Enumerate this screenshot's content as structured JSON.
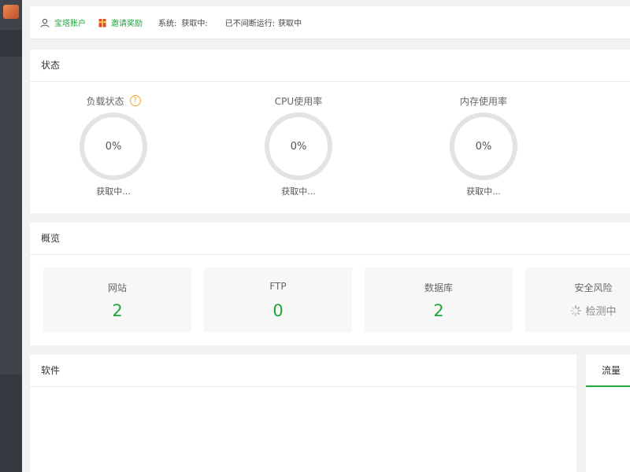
{
  "topbar": {
    "account_label": "宝塔账户",
    "invite_label": "邀请奖励",
    "system_label": "系统:",
    "system_value": "获取中:",
    "uptime_label": "已不间断运行:",
    "uptime_value": "获取中"
  },
  "status": {
    "title": "状态",
    "gauges": [
      {
        "title": "负载状态",
        "value": "0%",
        "sub": "获取中...",
        "percent": 0
      },
      {
        "title": "CPU使用率",
        "value": "0%",
        "sub": "获取中...",
        "percent": 0
      },
      {
        "title": "内存使用率",
        "value": "0%",
        "sub": "获取中...",
        "percent": 0
      }
    ],
    "help_glyph": "?"
  },
  "overview": {
    "title": "概览",
    "cards": [
      {
        "label": "网站",
        "value": "2"
      },
      {
        "label": "FTP",
        "value": "0"
      },
      {
        "label": "数据库",
        "value": "2"
      },
      {
        "label": "安全风险",
        "value": "检测中"
      }
    ]
  },
  "software": {
    "title": "软件"
  },
  "traffic": {
    "tab_label": "流量"
  },
  "colors": {
    "accent": "#20a53a",
    "warn": "#f0a020",
    "sidebar": "#3f444b"
  },
  "icons": {
    "account": "user-icon",
    "invite": "gift-icon",
    "help": "help-icon",
    "loading": "spinner-icon"
  }
}
